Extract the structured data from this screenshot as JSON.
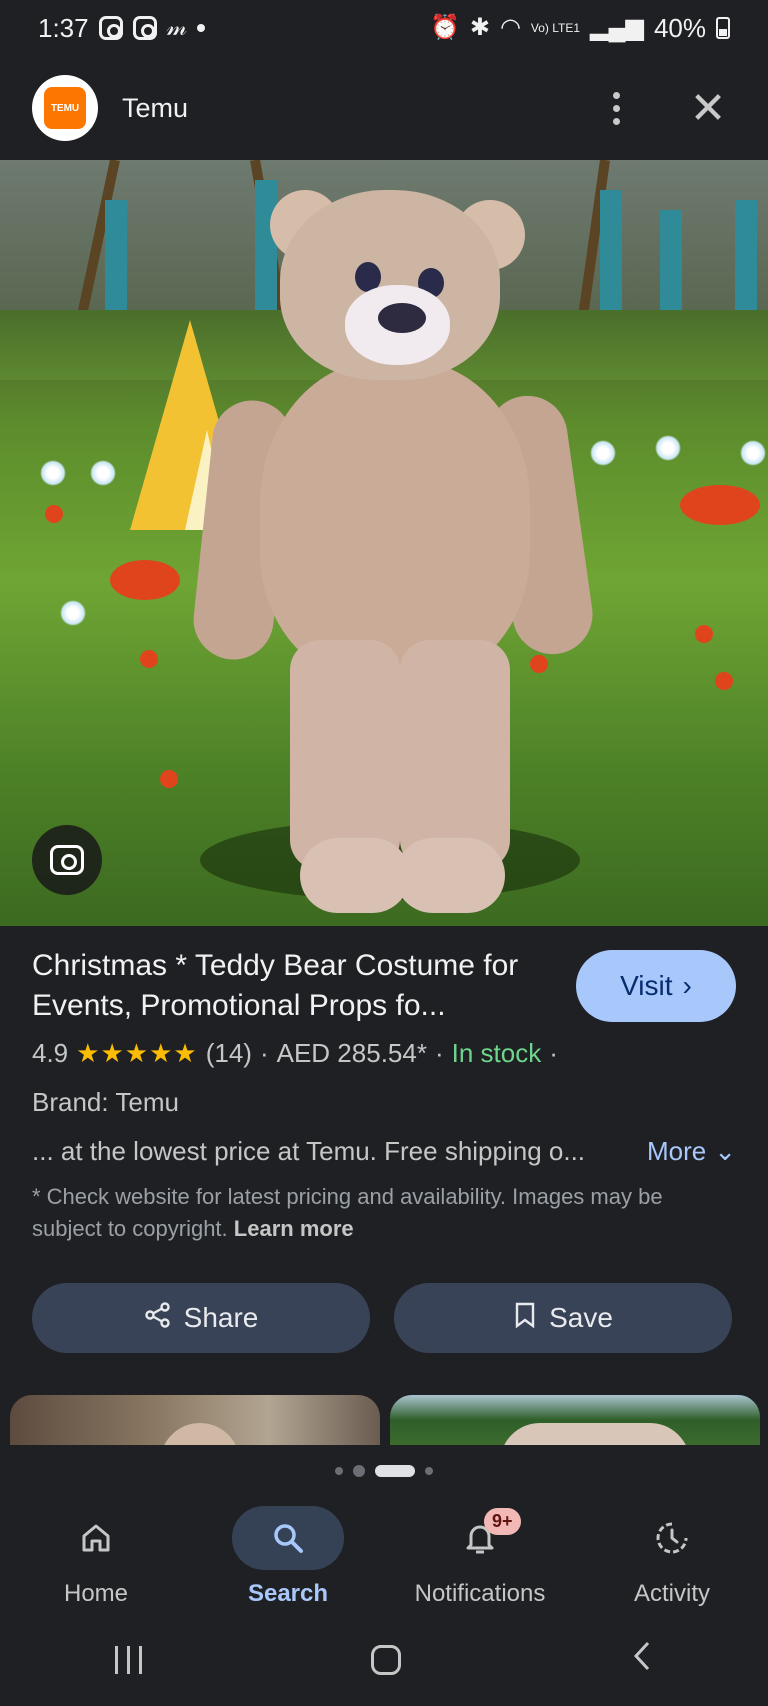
{
  "status_bar": {
    "time": "1:37",
    "network": "Vo) LTE1",
    "battery": "40%",
    "icons": [
      "instagram-icon",
      "instagram-icon",
      "myntra-icon",
      "notification-dot",
      "alarm-icon",
      "bluetooth-icon",
      "wifi-icon",
      "signal-icon",
      "battery-icon"
    ]
  },
  "app": {
    "title": "Temu",
    "logo_text": "TEMU"
  },
  "product": {
    "title": "Christmas * Teddy Bear Costume for Events, Promotional Props fo...",
    "visit_label": "Visit",
    "rating": "4.9",
    "stars": "★★★★★",
    "review_count": "(14)",
    "separator": "·",
    "price": "AED 285.54*",
    "stock": "In stock",
    "brand": "Brand: Temu",
    "description": "... at the lowest price at Temu. Free shipping o...",
    "more_label": "More",
    "disclaimer": "* Check website for latest pricing and availability. Images may be subject to copyright.",
    "learn_more": "Learn more"
  },
  "actions": {
    "share_label": "Share",
    "save_label": "Save"
  },
  "nav": {
    "items": [
      {
        "label": "Home",
        "icon": "home-icon"
      },
      {
        "label": "Search",
        "icon": "search-icon"
      },
      {
        "label": "Notifications",
        "icon": "bell-icon",
        "badge": "9+"
      },
      {
        "label": "Activity",
        "icon": "activity-icon"
      }
    ],
    "active_index": 1
  },
  "colors": {
    "background": "#1f2024",
    "accent": "#a8c7fa",
    "stock_green": "#6dd58c",
    "star": "#fbbc04",
    "brand_orange": "#fb7701"
  }
}
